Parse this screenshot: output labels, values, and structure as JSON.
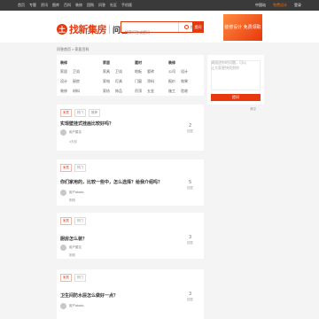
{
  "topbar": {
    "nav": [
      "首页",
      "专题",
      "资讯",
      "图库",
      "百科",
      "装修",
      "团购",
      "问答",
      "社区",
      "手机版"
    ],
    "right": [
      "中国站",
      "免费设计",
      "登录"
    ]
  },
  "logo": {
    "mark": "土",
    "text": "找新集房",
    "sub": "问答"
  },
  "search": {
    "placeholder": "搜索问答或提问",
    "button_label": "搜索",
    "ask_label": "提问"
  },
  "banner": {
    "text": "装修设计 免费领取"
  },
  "breadcrumb": "问答首页 > 家居百科",
  "categories": [
    {
      "head": "装修",
      "items": [
        "家居",
        "卫浴",
        "设计",
        "厨房",
        "装修",
        "材料",
        "客厅",
        "风水"
      ]
    },
    {
      "head": "家居",
      "items": [
        "家具",
        "卫浴",
        "家电",
        "灯具",
        "家纺",
        "饰品"
      ]
    },
    {
      "head": "建材",
      "items": [
        "地板",
        "瓷砖",
        "门窗",
        "涂料",
        "吊顶",
        "五金"
      ]
    },
    {
      "head": "装修",
      "items": [
        "公司",
        "设计",
        "报价",
        "效果",
        "施工",
        "验收"
      ]
    }
  ],
  "questions": [
    {
      "tags": [
        "家居",
        "热门",
        "推荐"
      ],
      "title": "实现壁挂式挂画比较好吗？",
      "user": "用户匿名",
      "time": "4天前",
      "count": "2",
      "count_label": "回答"
    },
    {
      "tags": [
        "家居",
        "热门"
      ],
      "title": "你们家用的，比较一些中，怎么选择？给我介绍吗？",
      "user": "用户ababc",
      "time": "刚刚",
      "count": "5",
      "count_label": "回答"
    },
    {
      "tags": [
        "家居",
        "热门"
      ],
      "title": "厨房怎么装？",
      "user": "用户匿名",
      "time": "刚刚",
      "count": "3",
      "count_label": "回答"
    },
    {
      "tags": [
        "家居",
        "热门"
      ],
      "title": "卫生间防水层怎么做好一点？",
      "user": "用户ababc",
      "time": "刚刚",
      "count": "3",
      "count_label": "回答"
    }
  ],
  "side": {
    "placeholder": "请描述你的问题，可以让大家更快找到你",
    "ask_label": "提问",
    "clear_label": "清空"
  }
}
